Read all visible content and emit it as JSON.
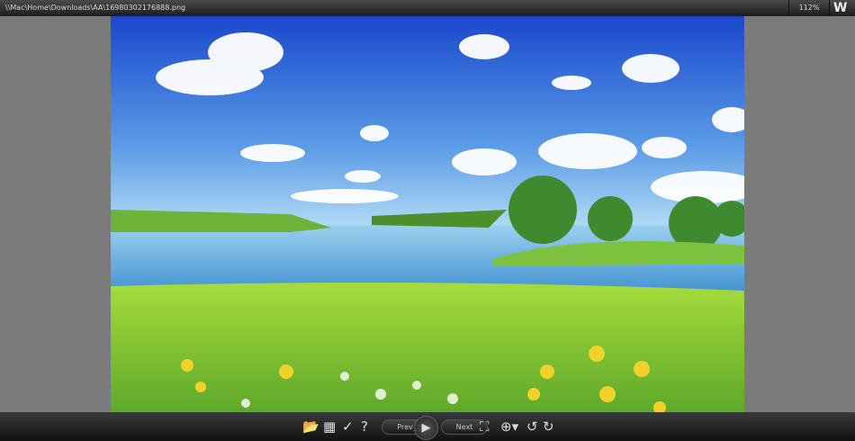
{
  "titlebar": {
    "path": "\\\\Mac\\Home\\Downloads\\AA\\16980302176888.png",
    "zoom": "112%",
    "logo": "W"
  },
  "toolbar": {
    "prev": "Prev",
    "next": "Next",
    "icons": [
      "open-folder-icon",
      "save-icon",
      "check-icon",
      "help-icon",
      "play-icon",
      "fit-screen-icon",
      "zoom-menu-icon",
      "rotate-left-icon",
      "rotate-right-icon"
    ]
  },
  "colors": {
    "sky_top": "#1d4fd0",
    "sky_bottom": "#8cc7f0",
    "grass": "#8fd43a",
    "water": "#6fb5e3"
  }
}
